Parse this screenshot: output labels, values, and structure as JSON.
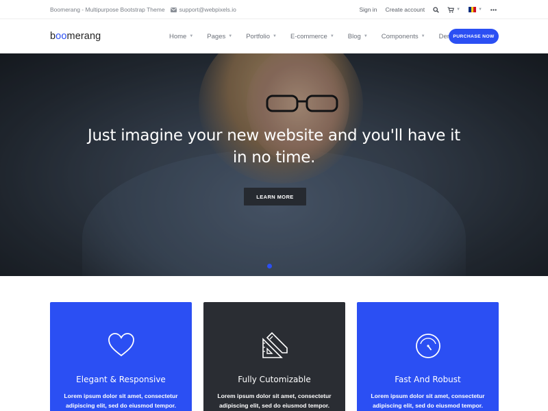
{
  "topbar": {
    "tagline": "Boomerang - Multipurpose Bootstrap Theme",
    "email": "support@webpixels.io",
    "sign_in": "Sign in",
    "create_account": "Create account",
    "icons": [
      "search-icon",
      "cart-icon",
      "flag-icon",
      "more-icon"
    ]
  },
  "navbar": {
    "logo_prefix": "b",
    "logo_accent": "oo",
    "logo_suffix": "merang",
    "items": [
      {
        "label": "Home",
        "has_dropdown": true
      },
      {
        "label": "Pages",
        "has_dropdown": true
      },
      {
        "label": "Portfolio",
        "has_dropdown": true
      },
      {
        "label": "E-commerce",
        "has_dropdown": true
      },
      {
        "label": "Blog",
        "has_dropdown": true
      },
      {
        "label": "Components",
        "has_dropdown": true
      },
      {
        "label": "Demos",
        "has_dropdown": false
      }
    ],
    "cta": "PURCHASE NOW"
  },
  "hero": {
    "title_line1": "Just imagine your new website and you'll have it",
    "title_line2": "in no time.",
    "button": "LEARN MORE",
    "slide_count": 1,
    "active_slide": 1
  },
  "features": [
    {
      "title": "Elegant & Responsive",
      "text": "Lorem ipsum dolor sit amet, consectetur adipiscing elit, sed do eiusmod tempor.",
      "icon": "heart-icon",
      "bg": "#2b4ff3"
    },
    {
      "title": "Fully Cutomizable",
      "text": "Lorem ipsum dolor sit amet, consectetur adipiscing elit, sed do eiusmod tempor.",
      "icon": "ruler-pencil-icon",
      "bg": "#2a2d33"
    },
    {
      "title": "Fast And Robust",
      "text": "Lorem ipsum dolor sit amet, consectetur adipiscing elit, sed do eiusmod tempor.",
      "icon": "speedometer-icon",
      "bg": "#2b4ff3"
    }
  ],
  "colors": {
    "accent": "#2b4ff3",
    "dark": "#2a2d33"
  }
}
